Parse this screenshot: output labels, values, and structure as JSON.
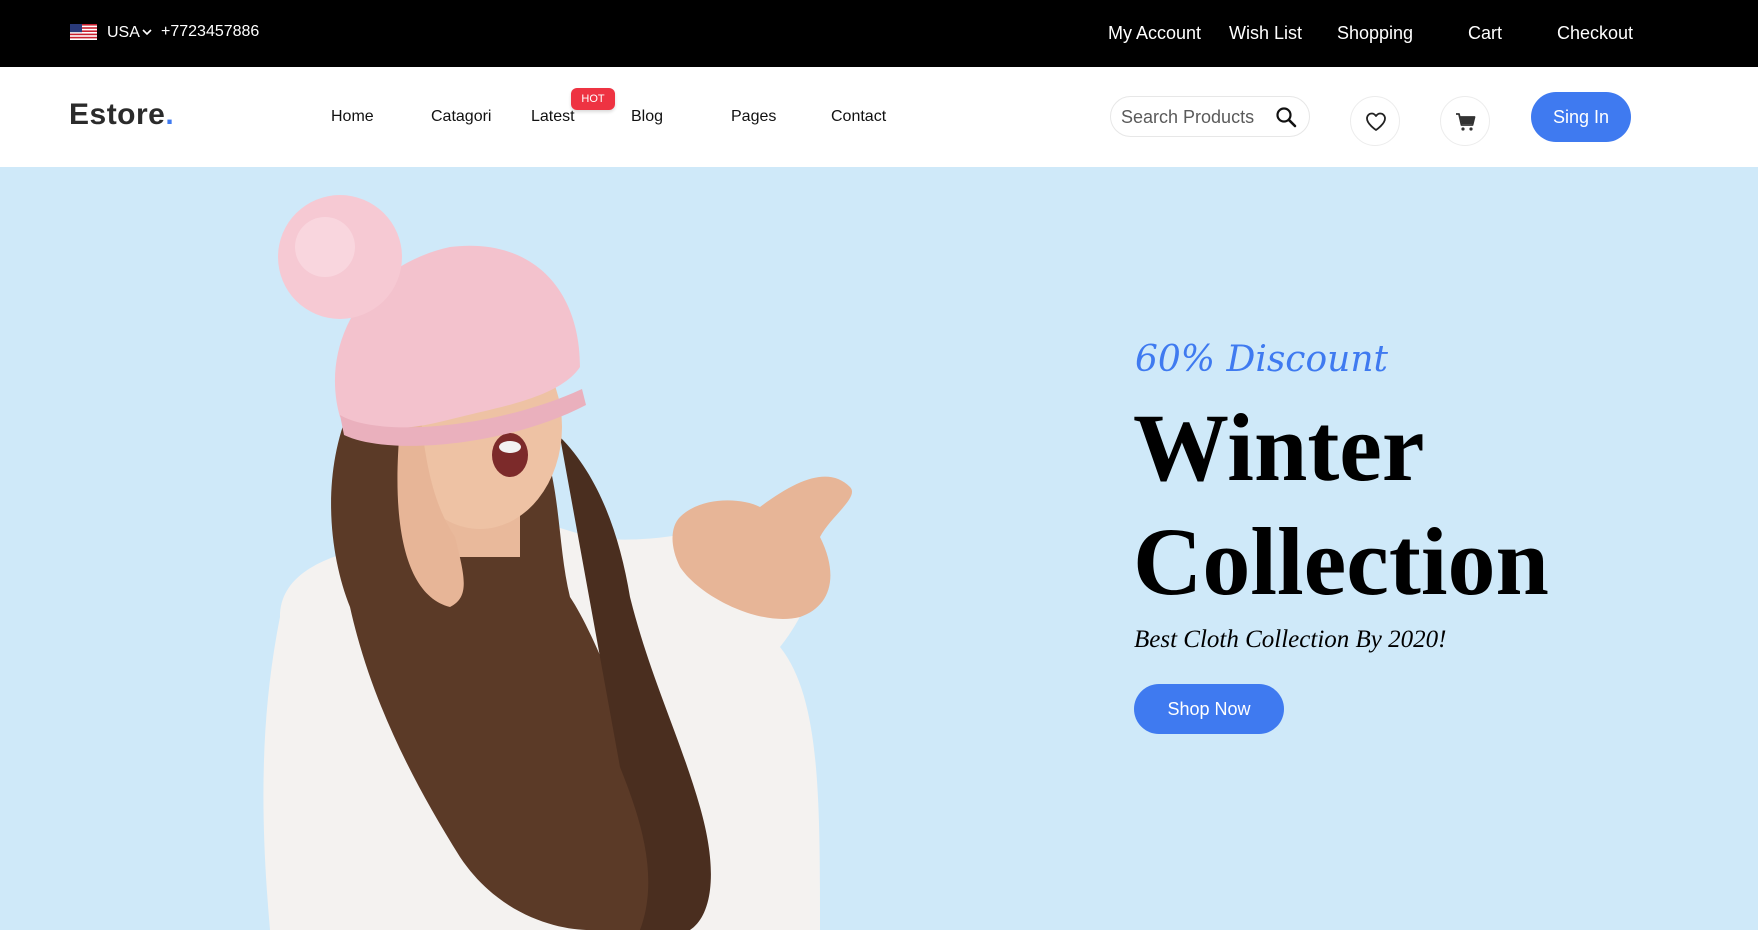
{
  "topbar": {
    "country": "USA",
    "phone": "+7723457886",
    "links": {
      "my_account": "My Account",
      "wish_list": "Wish List",
      "shopping": "Shopping",
      "cart": "Cart",
      "checkout": "Checkout"
    }
  },
  "brand": {
    "logo_text": "Estore",
    "logo_dot": ".",
    "accent_color": "#3f7af0",
    "hot_badge_color": "#ee3342"
  },
  "nav": {
    "home": "Home",
    "catagori": "Catagori",
    "latest": "Latest",
    "hot_badge": "HOT",
    "blog": "Blog",
    "pages": "Pages",
    "contact": "Contact"
  },
  "search": {
    "placeholder": "Search Products",
    "icon": "search-icon"
  },
  "actions": {
    "wishlist_icon": "heart-icon",
    "cart_icon": "cart-icon",
    "signin_label": "Sing In"
  },
  "hero": {
    "background": "#cfe9f9",
    "discount": "60% Discount",
    "title_line1": "Winter",
    "title_line2": "Collection",
    "tagline": "Best Cloth Collection By 2020!",
    "cta_label": "Shop Now"
  }
}
